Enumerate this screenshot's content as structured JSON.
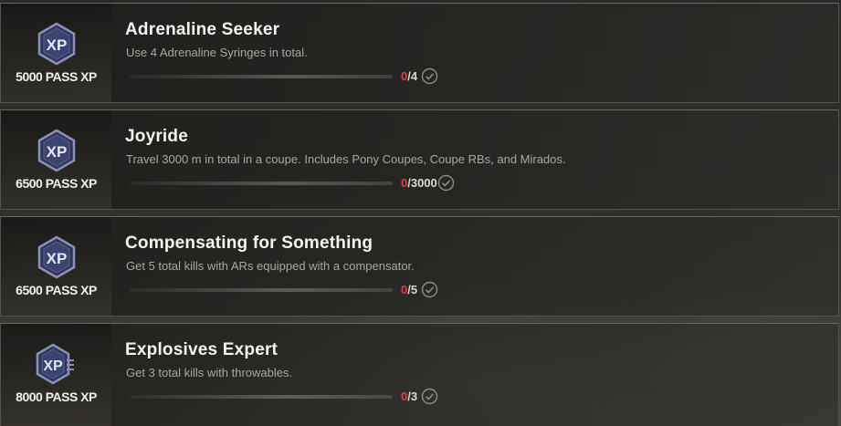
{
  "challenges": [
    {
      "reward": "5000 PASS XP",
      "title": "Adrenaline Seeker",
      "description": "Use 4 Adrenaline Syringes in total.",
      "current": "0",
      "total": "/4"
    },
    {
      "reward": "6500 PASS XP",
      "title": "Joyride",
      "description": "Travel 3000 m in total in a coupe. Includes Pony Coupes, Coupe RBs, and Mirados.",
      "current": "0",
      "total": "/3000"
    },
    {
      "reward": "6500 PASS XP",
      "title": "Compensating for Something",
      "description": "Get 5 total kills with ARs equipped with a compensator.",
      "current": "0",
      "total": "/5"
    },
    {
      "reward": "8000 PASS XP",
      "title": "Explosives Expert",
      "description": "Get 3 total kills with throwables.",
      "current": "0",
      "total": "/3"
    }
  ],
  "icons": {
    "reward": "xp-badge-icon",
    "status": "check-circle-icon"
  },
  "colors": {
    "progress_current": "#d8414f",
    "badge": "#2e3556"
  }
}
